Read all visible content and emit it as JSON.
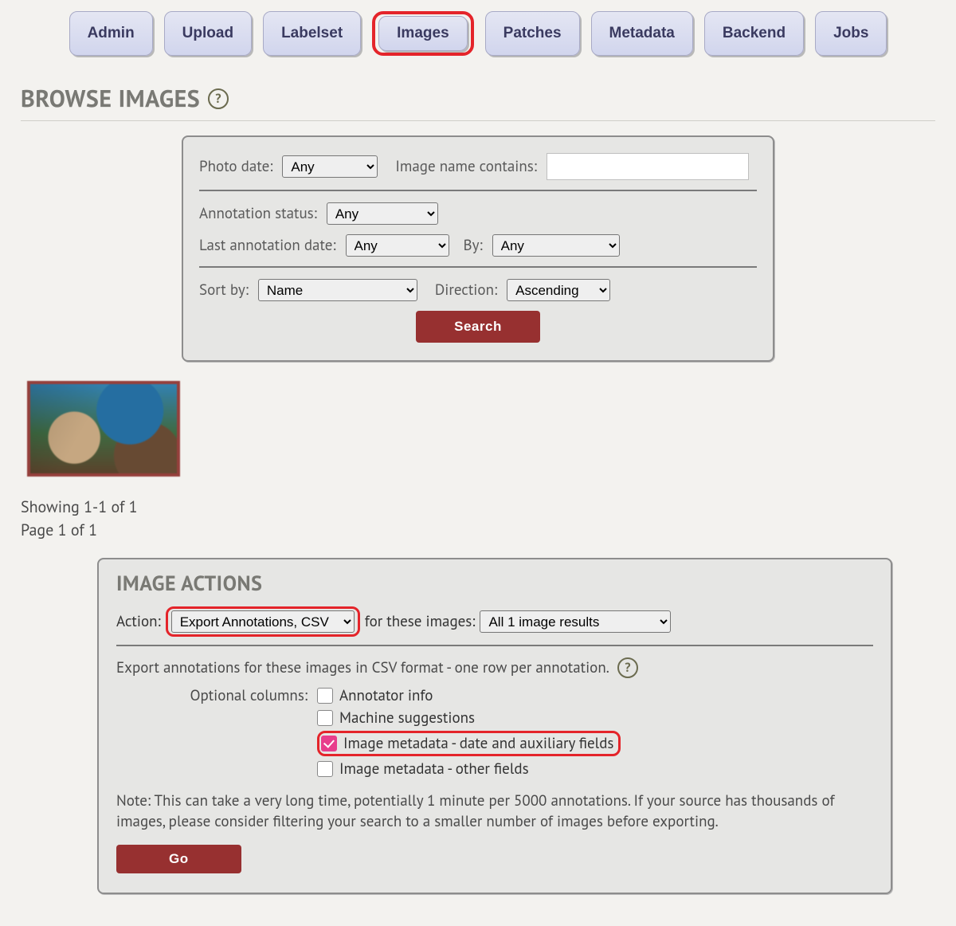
{
  "tabs": {
    "admin": "Admin",
    "upload": "Upload",
    "labelset": "Labelset",
    "images": "Images",
    "patches": "Patches",
    "metadata": "Metadata",
    "backend": "Backend",
    "jobs": "Jobs"
  },
  "heading": "BROWSE IMAGES",
  "help_glyph": "?",
  "search": {
    "photo_date_label": "Photo date:",
    "photo_date_value": "Any",
    "name_contains_label": "Image name contains:",
    "name_contains_value": "",
    "annotation_status_label": "Annotation status:",
    "annotation_status_value": "Any",
    "last_annotation_date_label": "Last annotation date:",
    "last_annotation_date_value": "Any",
    "by_label": "By:",
    "by_value": "Any",
    "sort_by_label": "Sort by:",
    "sort_by_value": "Name",
    "direction_label": "Direction:",
    "direction_value": "Ascending",
    "search_button": "Search"
  },
  "pager": {
    "line1": "Showing 1-1 of 1",
    "line2": "Page 1 of 1"
  },
  "actions": {
    "title": "IMAGE ACTIONS",
    "action_label": "Action:",
    "action_value": "Export Annotations, CSV",
    "for_these_images_prefix": "for these images:",
    "scope_value": "All 1 image results",
    "export_description": "Export annotations for these images in CSV format - one row per annotation.",
    "optional_columns_label": "Optional columns:",
    "opt_annotator_info": "Annotator info",
    "opt_machine_suggestions": "Machine suggestions",
    "opt_metadata_date_aux": "Image metadata - date and auxiliary fields",
    "opt_metadata_other": "Image metadata - other fields",
    "note": "Note: This can take a very long time, potentially 1 minute per 5000 annotations. If your source has thousands of images, please consider filtering your search to a smaller number of images before exporting.",
    "go_button": "Go"
  }
}
